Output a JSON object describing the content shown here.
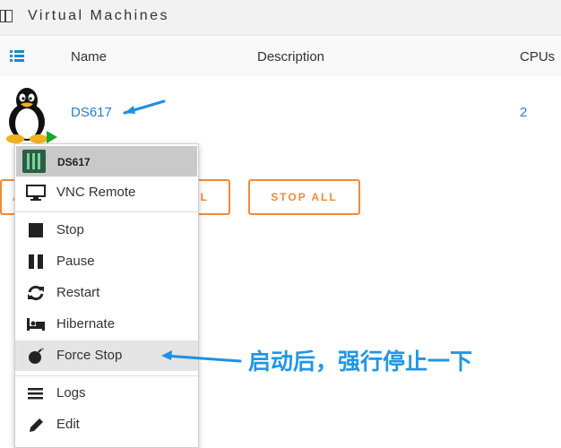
{
  "window": {
    "title": "Virtual Machines"
  },
  "columns": {
    "name": "Name",
    "description": "Description",
    "cpus": "CPUs"
  },
  "vm": {
    "name": "DS617",
    "cpus": "2",
    "description": ""
  },
  "actions": {
    "left_partial": "A",
    "middle_partial": "L",
    "stop_all": "STOP ALL"
  },
  "context_menu": {
    "title": "DS617",
    "items": [
      {
        "label": "VNC Remote",
        "icon": "monitor-icon"
      },
      {
        "label": "Stop",
        "icon": "stop-icon"
      },
      {
        "label": "Pause",
        "icon": "pause-icon"
      },
      {
        "label": "Restart",
        "icon": "restart-icon"
      },
      {
        "label": "Hibernate",
        "icon": "bed-icon"
      },
      {
        "label": "Force Stop",
        "icon": "bomb-icon"
      },
      {
        "label": "Logs",
        "icon": "menu-lines-icon"
      },
      {
        "label": "Edit",
        "icon": "pencil-icon"
      }
    ]
  },
  "annotation": {
    "text": "启动后，强行停止一下"
  },
  "colors": {
    "link": "#2a7bd0",
    "accent_orange": "#f08a3a",
    "annotation_blue": "#2196e6",
    "play_green": "#17a82b"
  }
}
